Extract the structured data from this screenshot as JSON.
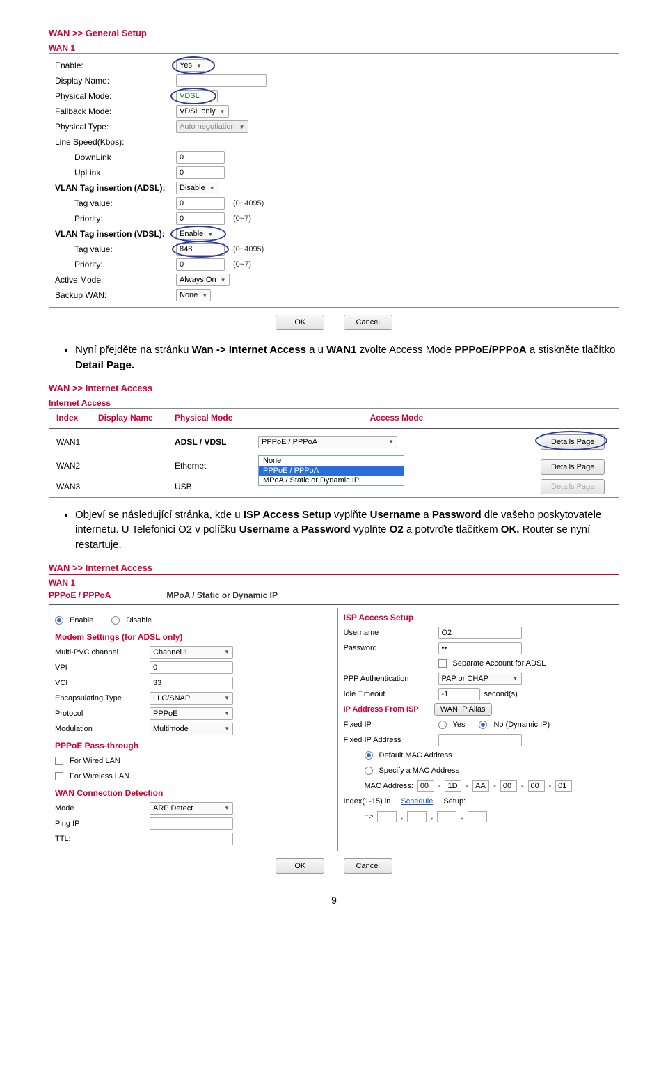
{
  "page_number": "9",
  "general": {
    "title": "WAN >> General Setup",
    "wan_label": "WAN 1",
    "rows": {
      "enable": "Enable:",
      "enable_v": "Yes",
      "display": "Display Name:",
      "phys_mode": "Physical Mode:",
      "phys_mode_v": "VDSL",
      "fallback": "Fallback Mode:",
      "fallback_v": "VDSL only",
      "phys_type": "Physical Type:",
      "phys_type_v": "Auto negotiation",
      "line_speed": "Line Speed(Kbps):",
      "down": "DownLink",
      "down_v": "0",
      "up": "UpLink",
      "up_v": "0",
      "vlan_adsl": "VLAN Tag insertion (ADSL):",
      "vlan_adsl_v": "Disable",
      "tag": "Tag value:",
      "tag_adsl_v": "0",
      "tag_adsl_h": "(0~4095)",
      "prio": "Priority:",
      "prio_adsl_v": "0",
      "prio_adsl_h": "(0~7)",
      "vlan_vdsl": "VLAN Tag insertion (VDSL):",
      "vlan_vdsl_v": "Enable",
      "tag_vdsl_v": "848",
      "tag_vdsl_h": "(0~4095)",
      "prio_vdsl_v": "0",
      "prio_vdsl_h": "(0~7)",
      "active": "Active Mode:",
      "active_v": "Always On",
      "backup": "Backup WAN:",
      "backup_v": "None"
    },
    "ok": "OK",
    "cancel": "Cancel"
  },
  "instr1a": "Nyní přejděte na stránku ",
  "instr1b": "Wan -> Internet Access",
  "instr1c": " a u ",
  "instr1d": "WAN1",
  "instr1e": " zvolte Access Mode ",
  "instr1f": "PPPoE/PPPoA",
  "instr1g": " a stiskněte tlačítko ",
  "instr1h": "Detail Page.",
  "ia": {
    "title": "WAN >> Internet Access",
    "sub": "Internet Access",
    "h_index": "Index",
    "h_disp": "Display Name",
    "h_phys": "Physical Mode",
    "h_mode": "Access Mode",
    "w1": "WAN1",
    "w1_phys": "ADSL / VDSL",
    "w1_sel": "PPPoE / PPPoA",
    "w2": "WAN2",
    "w2_phys": "Ethernet",
    "w3": "WAN3",
    "w3_phys": "USB",
    "opt_none": "None",
    "opt_pppoe": "PPPoE / PPPoA",
    "opt_mpoa": "MPoA / Static or Dynamic IP",
    "details": "Details Page"
  },
  "instr2_parts": [
    "Objeví se následující stránka, kde u ",
    "ISP Access Setup",
    " vyplňte ",
    "Username",
    " a ",
    "Password",
    " dle vašeho poskytovatele internetu. U Telefonici O2 v políčku ",
    "Username",
    " a ",
    "Password",
    " vyplňte ",
    "O2",
    " a potvrďte tlačítkem ",
    "OK.",
    " Router se nyní restartuje."
  ],
  "pp": {
    "title": "WAN >> Internet Access",
    "wan_label": "WAN 1",
    "tab1": "PPPoE / PPPoA",
    "tab2": "MPoA / Static or Dynamic IP",
    "enable": "Enable",
    "disable": "Disable",
    "modem_head": "Modem Settings (for ADSL only)",
    "mpvc": "Multi-PVC channel",
    "mpvc_v": "Channel 1",
    "vpi": "VPI",
    "vpi_v": "0",
    "vci": "VCI",
    "vci_v": "33",
    "enc": "Encapsulating Type",
    "enc_v": "LLC/SNAP",
    "proto": "Protocol",
    "proto_v": "PPPoE",
    "modu": "Modulation",
    "modu_v": "Multimode",
    "pthru_head": "PPPoE Pass-through",
    "wired": "For Wired LAN",
    "wless": "For Wireless LAN",
    "wcd_head": "WAN Connection Detection",
    "mode": "Mode",
    "mode_v": "ARP Detect",
    "ping": "Ping IP",
    "ttl": "TTL:",
    "isp_head": "ISP Access Setup",
    "user": "Username",
    "user_v": "O2",
    "pass": "Password",
    "pass_v": "••",
    "sep_adsl": "Separate Account for ADSL",
    "ppp_auth": "PPP Authentication",
    "ppp_auth_v": "PAP or CHAP",
    "idle": "Idle Timeout",
    "idle_v": "-1",
    "idle_u": "second(s)",
    "ip_head": "IP Address From ISP",
    "wan_alias_btn": "WAN IP Alias",
    "fixed": "Fixed IP",
    "yes": "Yes",
    "no": "No (Dynamic IP)",
    "fixed_addr": "Fixed IP Address",
    "def_mac": "Default MAC Address",
    "spec_mac": "Specify a MAC Address",
    "mac_lbl": "MAC Address:",
    "mac": [
      "00",
      "1D",
      "AA",
      "00",
      "00",
      "01"
    ],
    "sched": "Index(1-15) in",
    "sched_link": "Schedule",
    "sched_tail": "Setup:",
    "arrow": "=>"
  }
}
